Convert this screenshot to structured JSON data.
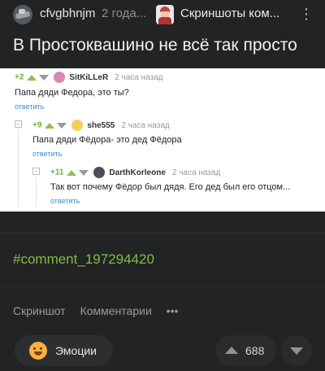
{
  "header": {
    "author": "cfvgbhnjm",
    "age": "2 года...",
    "community": "Скриншоты ком...",
    "menu_icon": "more-vertical-icon"
  },
  "post": {
    "title": "В Простоквашино не всё так просто"
  },
  "comments": [
    {
      "score": "+2",
      "username": "SitKiLLeR",
      "time": "2 часа назад",
      "text": "Папа дяди Федора, это ты?",
      "reply": "ответить",
      "avatar_color": "#d98ab0"
    },
    {
      "score": "+9",
      "username": "she555",
      "time": "2 часа назад",
      "text": "Папа дяди Фёдора- это дед Фёдора",
      "reply": "ответить",
      "avatar_color": "#f2d05a"
    },
    {
      "score": "+11",
      "username": "DarthKorleone",
      "time": "2 часа назад",
      "text": "Так вот почему Фёдор был дядя. Его дед был его отцом...",
      "reply": "ответить",
      "avatar_color": "#4a4f57"
    }
  ],
  "tag": "#comment_197294420",
  "actions": {
    "screenshot": "Скриншот",
    "comments": "Комментарии",
    "more": "•••"
  },
  "footer": {
    "emotions_label": "Эмоции",
    "rating": "688"
  },
  "colors": {
    "background": "#222324",
    "accent_green": "#7fbd44",
    "link_blue": "#3b8bd0"
  }
}
